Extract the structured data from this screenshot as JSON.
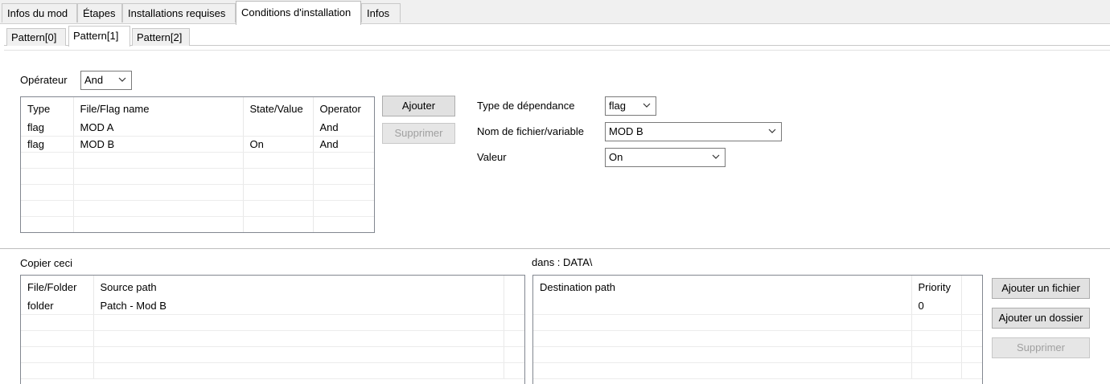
{
  "tabs": [
    "Infos du mod",
    "Étapes",
    "Installations requises",
    "Conditions d'installation",
    "Infos"
  ],
  "pattern_tabs": [
    "Pattern[0]",
    "Pattern[1]",
    "Pattern[2]"
  ],
  "conditions": {
    "operator_label": "Opérateur",
    "operator_value": "And",
    "columns": [
      "Type",
      "File/Flag name",
      "State/Value",
      "Operator"
    ],
    "rows": [
      [
        "flag",
        "MOD A",
        "",
        "And"
      ],
      [
        "flag",
        "MOD B",
        "On",
        "And"
      ]
    ],
    "add_button": "Ajouter",
    "remove_button": "Supprimer",
    "dependency_type_label": "Type de dépendance",
    "dependency_type_value": "flag",
    "filename_label": "Nom de fichier/variable",
    "filename_value": "MOD B",
    "value_label": "Valeur",
    "value_value": "On"
  },
  "files": {
    "copy_label": "Copier ceci",
    "into_label": "dans : DATA\\",
    "source_columns": [
      "File/Folder",
      "Source path"
    ],
    "source_rows": [
      [
        "folder",
        "Patch - Mod B"
      ]
    ],
    "dest_columns": [
      "Destination path",
      "Priority"
    ],
    "dest_rows": [
      [
        "",
        "0"
      ]
    ],
    "add_file_button": "Ajouter un fichier",
    "add_folder_button": "Ajouter un dossier",
    "remove_button": "Supprimer"
  }
}
